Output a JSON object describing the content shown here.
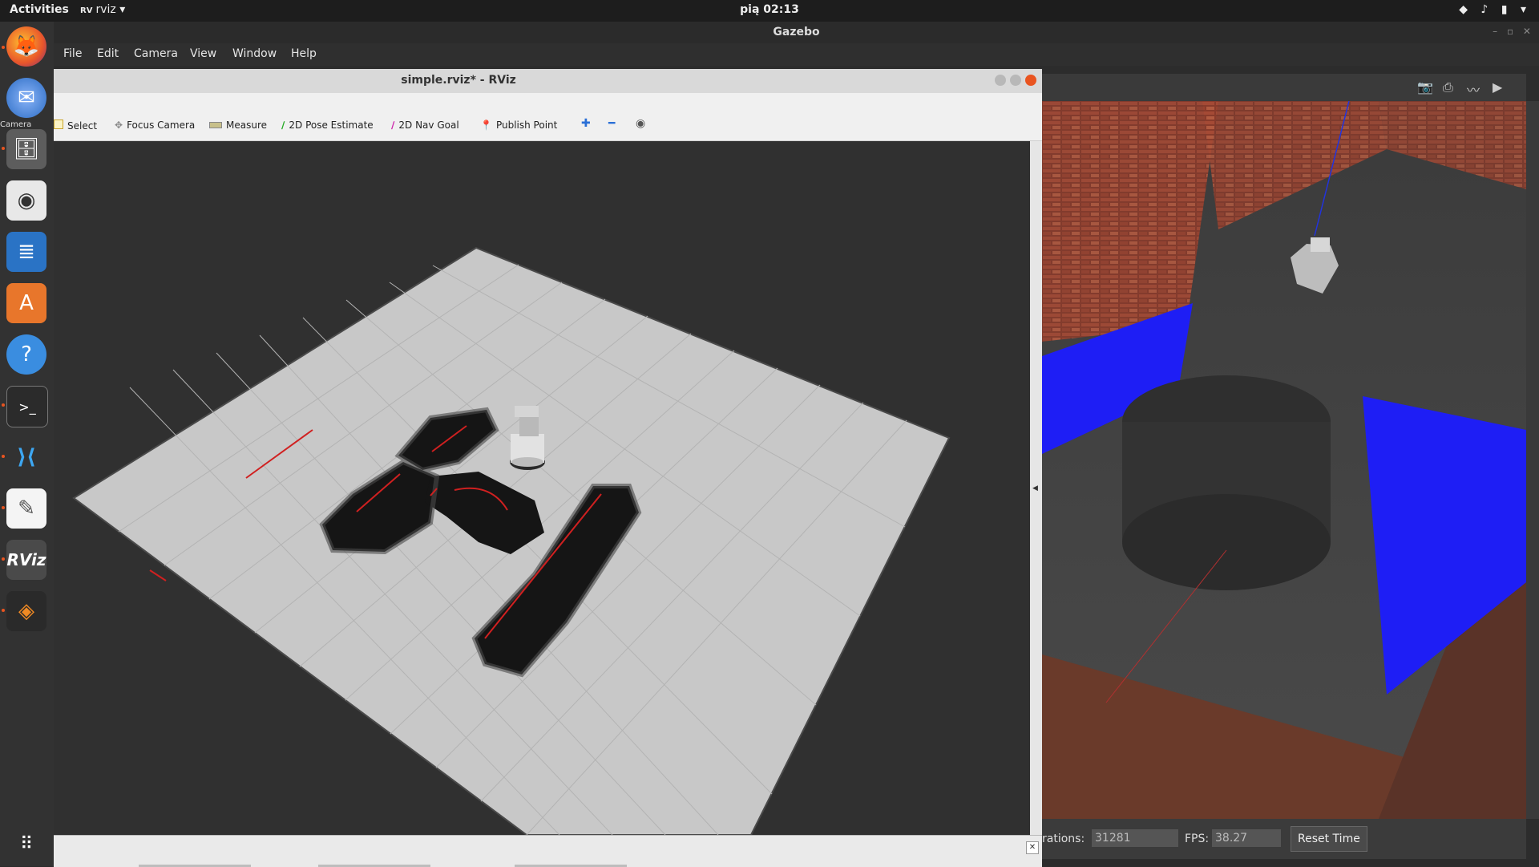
{
  "topbar": {
    "activities": "Activities",
    "app_name": "rviz",
    "clock": "pią 02:13",
    "tray": "◆ ♪ ▮ ▾"
  },
  "dock": {
    "items": [
      "firefox-icon",
      "thunderbird-icon",
      "files-icon",
      "rhythmbox-icon",
      "writer-icon",
      "software-icon",
      "help-icon",
      "terminal-icon",
      "vscode-icon",
      "text-editor-icon",
      "rviz-icon",
      "gazebo-icon",
      "show-apps-icon"
    ],
    "rviz_label": "RViz",
    "tooltip_label": "Camera"
  },
  "gazebo": {
    "title": "Gazebo",
    "menu": [
      "File",
      "Edit",
      "Camera",
      "View",
      "Window",
      "Help"
    ],
    "iterations_label": "rations:",
    "iterations_value": "31281",
    "fps_label": "FPS:",
    "fps_value": "38.27",
    "reset_button": "Reset Time"
  },
  "rviz": {
    "title": "simple.rviz* - RViz",
    "tools": [
      "Select",
      "Focus Camera",
      "Measure",
      "2D Pose Estimate",
      "2D Nav Goal",
      "Publish Point"
    ]
  },
  "colors": {
    "accent": "#e95420",
    "scene_bg": "#303030",
    "grid_floor": "#c8c8c8",
    "laser": "#1a1aff",
    "path": "#d02020"
  }
}
